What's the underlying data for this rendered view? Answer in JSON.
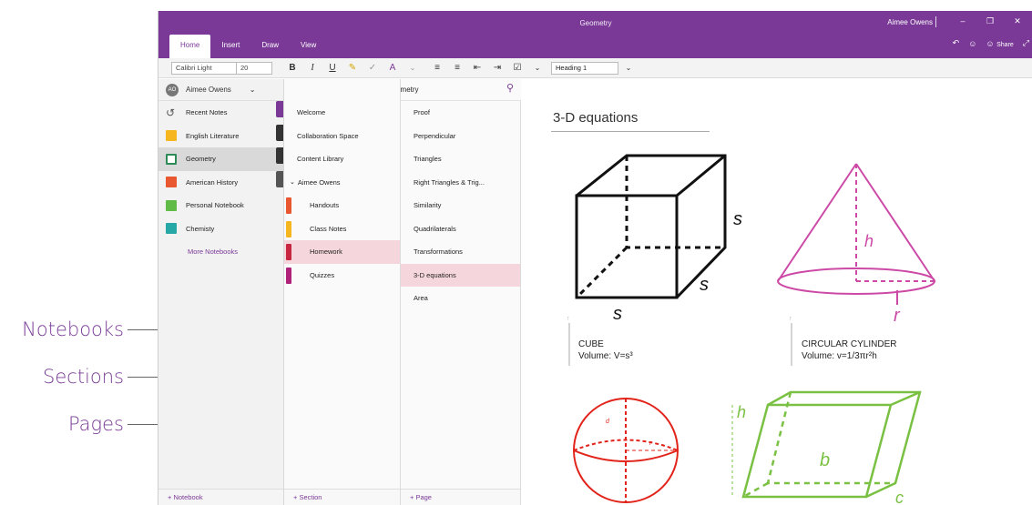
{
  "callouts": {
    "notebooks": "Notebooks",
    "sections": "Sections",
    "pages": "Pages"
  },
  "window": {
    "title": "Geometry",
    "user": "Aimee Owens"
  },
  "tabs": [
    "Home",
    "Insert",
    "Draw",
    "View"
  ],
  "share_label": "Share",
  "ribbon": {
    "font": "Calibri Light",
    "size": "20",
    "style": "Heading 1",
    "bold": "B",
    "italic": "I",
    "underline": "U"
  },
  "notebooks_pane": {
    "account": "Aimee Owens",
    "account_initials": "AO",
    "items": [
      {
        "label": "Recent Notes",
        "color": "#555555"
      },
      {
        "label": "English Literature",
        "color": "#f5b620"
      },
      {
        "label": "Geometry",
        "color": "#2e8b57"
      },
      {
        "label": "American History",
        "color": "#e8572f"
      },
      {
        "label": "Personal Notebook",
        "color": "#5fba46"
      },
      {
        "label": "Chemisty",
        "color": "#25a8a6"
      }
    ],
    "more": "More Notebooks",
    "add": "+ Notebook"
  },
  "sections_pane": {
    "header": "Geometry",
    "items": [
      {
        "label": "Welcome",
        "color": "#7a3997"
      },
      {
        "label": "Collaboration Space",
        "color": "#333333"
      },
      {
        "label": "Content Library",
        "color": "#333333"
      },
      {
        "label": "Aimee Owens",
        "color": "#555555"
      },
      {
        "label": "Handouts",
        "color": "#e8572f"
      },
      {
        "label": "Class Notes",
        "color": "#f5b620"
      },
      {
        "label": "Homework",
        "color": "#c6263f"
      },
      {
        "label": "Quizzes",
        "color": "#b0227a"
      }
    ],
    "add": "+ Section"
  },
  "pages_pane": {
    "items": [
      "Proof",
      "Perpendicular",
      "Triangles",
      "Right Triangles & Trig...",
      "Similarity",
      "Quadrilaterals",
      "Transformations",
      "3-D equations",
      "Area"
    ],
    "add": "+ Page"
  },
  "page": {
    "title": "3-D equations",
    "cube": {
      "name": "CUBE",
      "formula": "Volume: V=s³",
      "label": "s"
    },
    "cone": {
      "name": "CIRCULAR CYLINDER",
      "formula": "Volume: v=1/3πr²h",
      "h": "h",
      "r": "r"
    },
    "sphere": {
      "d": "d",
      "r": "r"
    },
    "prism": {
      "h": "h",
      "b": "b",
      "c": "c"
    }
  }
}
